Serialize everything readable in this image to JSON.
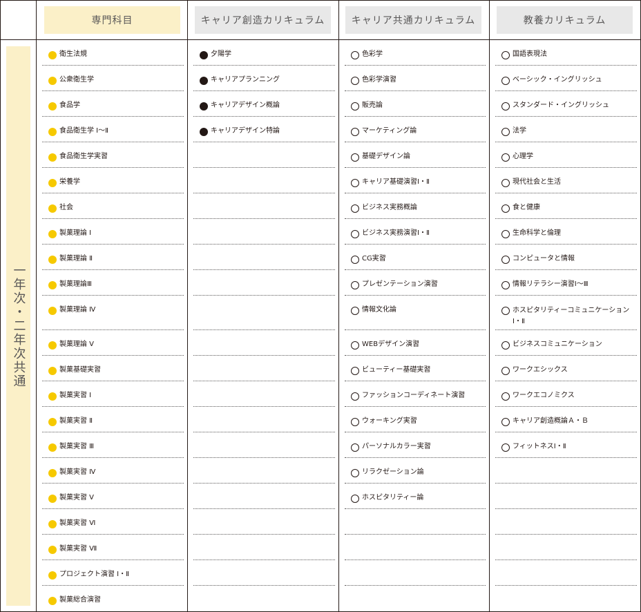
{
  "headers": [
    {
      "label": "専門科目",
      "bg": "#fbf0c8"
    },
    {
      "label": "キャリア創造カリキュラム",
      "bg": "#e8e8e8"
    },
    {
      "label": "キャリア共通カリキュラム",
      "bg": "#e8e8e8"
    },
    {
      "label": "教養カリキュラム",
      "bg": "#e8e8e8"
    }
  ],
  "side_label": "一年次・二年次共通",
  "side_bg": "#fbf0c8",
  "colors": {
    "yellow_marker": "#f6c900",
    "black_marker": "#231815",
    "border": "#231815"
  },
  "columns": [
    {
      "marker": "yellow",
      "items": [
        "衛生法規",
        "公衆衛生学",
        "食品学",
        "食品衛生学 Ⅰ～Ⅱ",
        "食品衛生学実習",
        "栄養学",
        "社会",
        "製菓理論 Ⅰ",
        "製菓理論 Ⅱ",
        "製菓理論Ⅲ",
        "製菓理論 Ⅳ",
        "製菓理論 Ⅴ",
        "製菓基礎実習",
        "製菓実習 Ⅰ",
        "製菓実習 Ⅱ",
        "製菓実習 Ⅲ",
        "製菓実習 Ⅳ",
        "製菓実習 Ⅴ",
        "製菓実習 Ⅵ",
        "製菓実習 Ⅶ",
        "プロジェクト演習 Ⅰ・Ⅱ",
        "製菓総合演習"
      ]
    },
    {
      "marker": "black",
      "items": [
        "夕陽学",
        "キャリアプランニング",
        "キャリアデザイン概論",
        "キャリアデザイン特論",
        "",
        "",
        "",
        "",
        "",
        "",
        "",
        "",
        "",
        "",
        "",
        "",
        "",
        "",
        "",
        "",
        "",
        ""
      ]
    },
    {
      "marker": "hollow",
      "items": [
        "色彩学",
        "色彩学演習",
        "販売論",
        "マーケティング論",
        "基礎デザイン論",
        "キャリア基礎演習Ⅰ・Ⅱ",
        "ビジネス実務概論",
        "ビジネス実務演習Ⅰ・Ⅱ",
        "CG実習",
        "プレゼンテーション演習",
        "情報文化論",
        "WEBデザイン演習",
        "ビューティー基礎実習",
        "ファッションコーディネート演習",
        "ウォーキング実習",
        "パーソナルカラー実習",
        "リラクゼーション論",
        "ホスピタリティー論",
        "",
        "",
        "",
        ""
      ]
    },
    {
      "marker": "hollow",
      "items": [
        "国語表現法",
        "ベーシック・イングリッシュ",
        "スタンダード・イングリッシュ",
        "法学",
        "心理学",
        "現代社会と生活",
        "食と健康",
        "生命科学と倫理",
        "コンピュータと情報",
        "情報リテラシー演習Ⅰ～Ⅲ",
        "ホスピタリティーコミュニケーション\nⅠ・Ⅱ",
        "ビジネスコミュニケーション",
        "ワークエシックス",
        "ワークエコノミクス",
        "キャリア創造概論Ａ・Ｂ",
        "フィットネスⅠ・Ⅱ",
        "",
        "",
        "",
        "",
        "",
        ""
      ]
    }
  ]
}
